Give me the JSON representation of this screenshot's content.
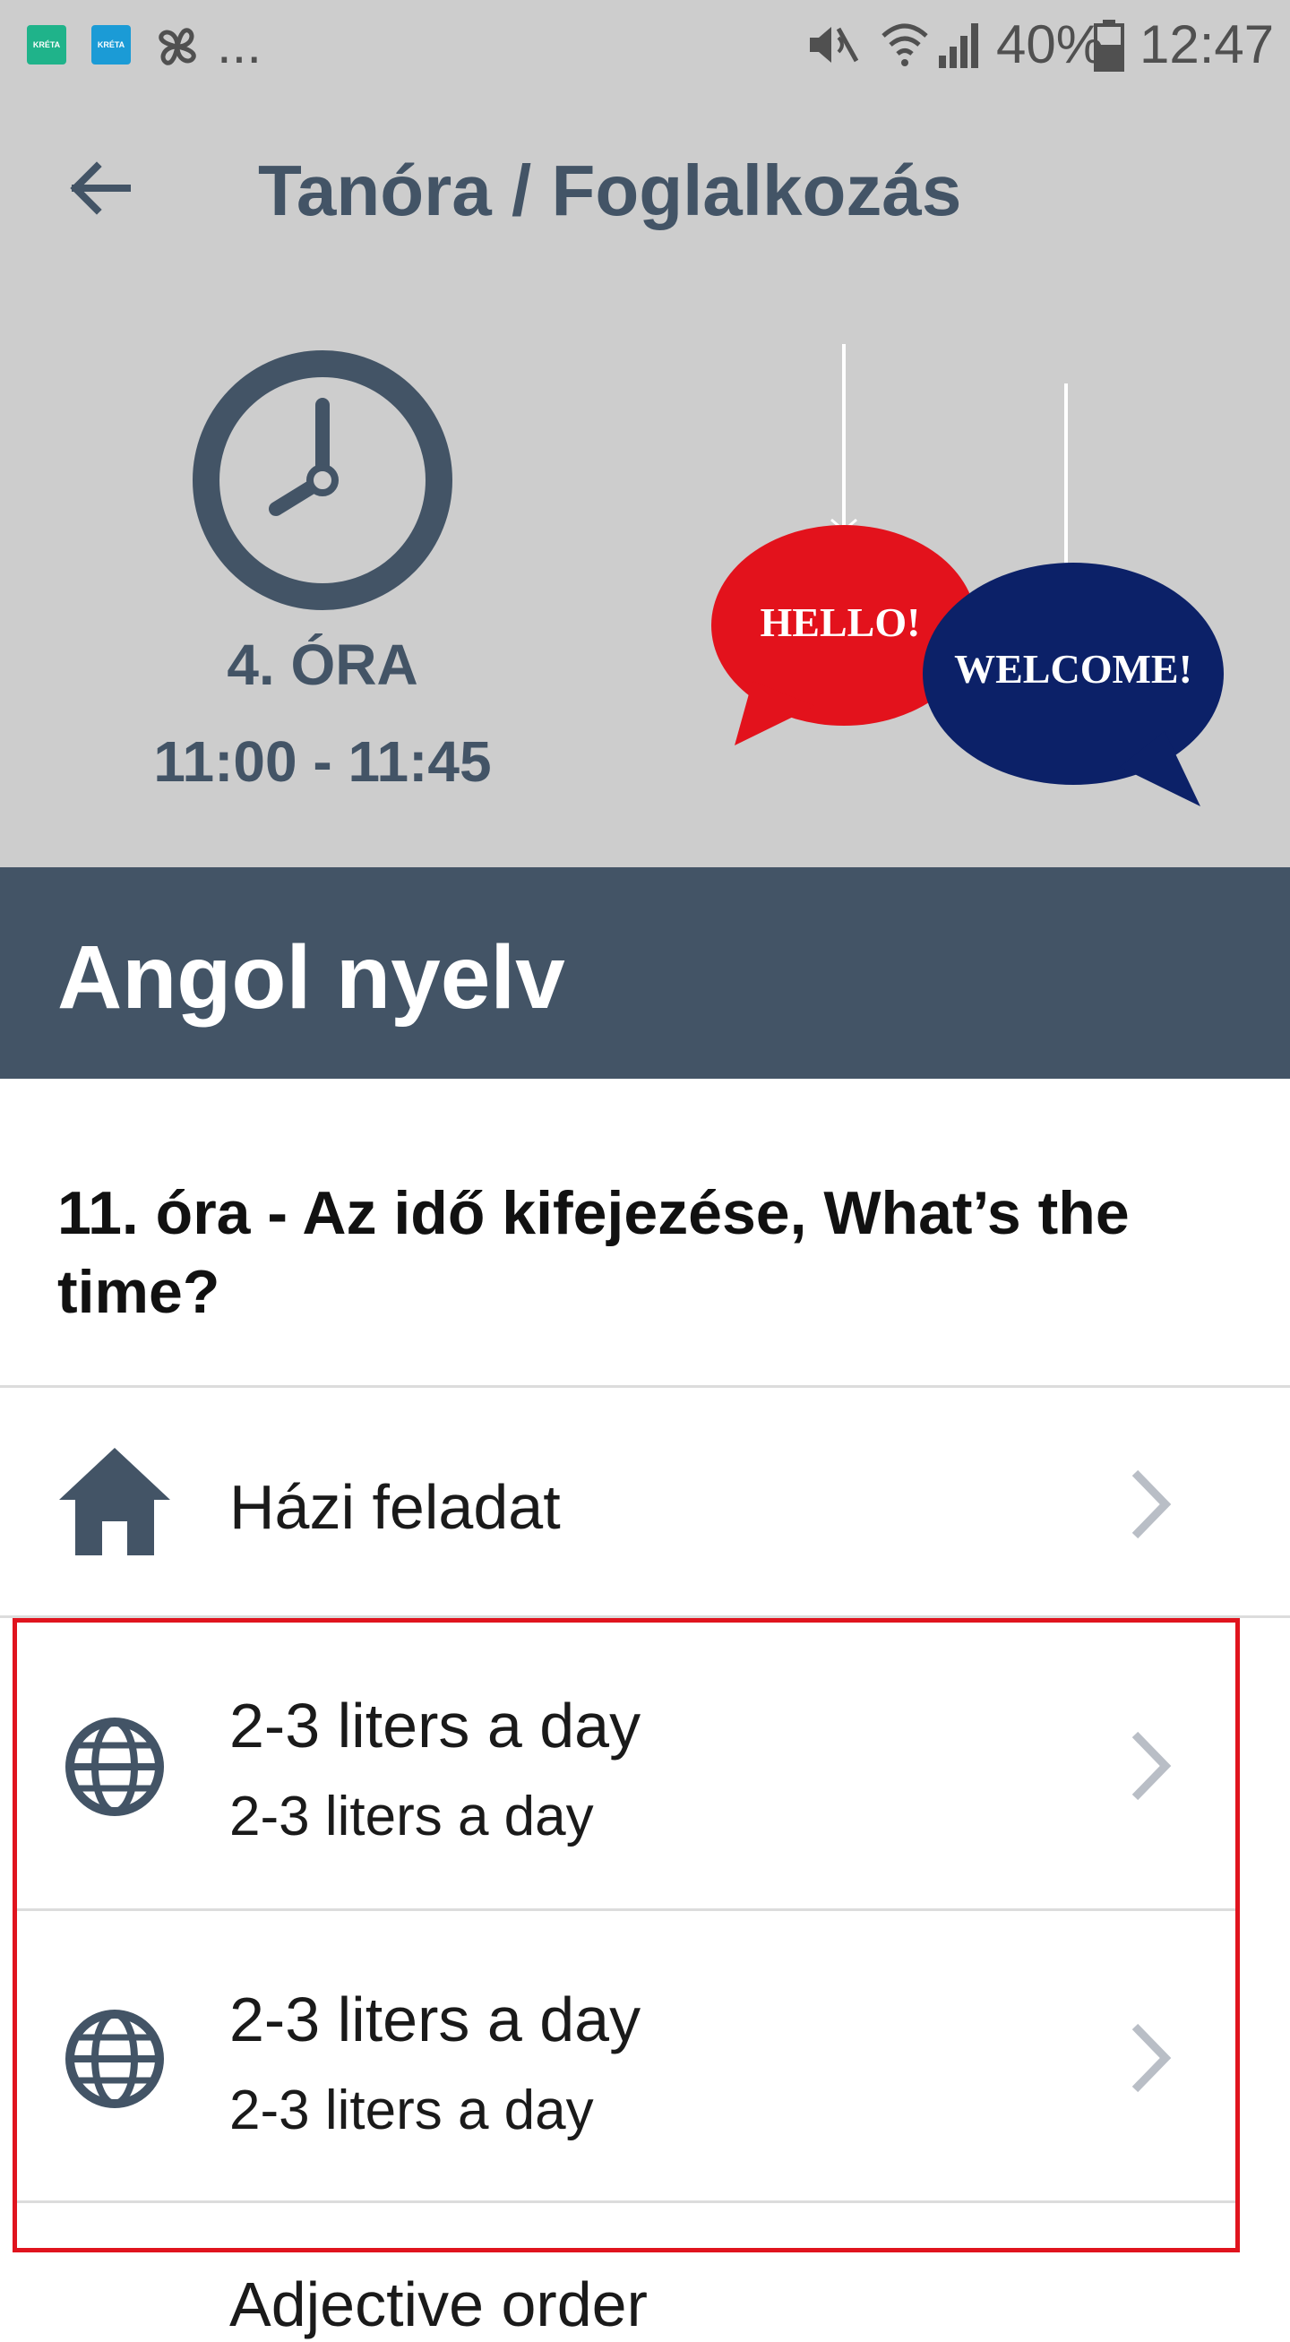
{
  "status_bar": {
    "notification_icons": [
      "kreta-app-icon",
      "kreta-app-icon",
      "pinwheel-icon"
    ],
    "more": "...",
    "icons": [
      "mute-icon",
      "wifi-icon",
      "signal-icon",
      "battery-icon"
    ],
    "battery": "40%",
    "clock": "12:47",
    "app_icon_label": "KRÉTA"
  },
  "header": {
    "title": "Tanóra / Foglalkozás",
    "back_icon": "arrow-left-icon"
  },
  "lesson": {
    "period": "4. ÓRA",
    "time_range": "11:00 - 11:45",
    "illustration": {
      "bubble_1": "HELLO!",
      "bubble_2": "WELCOME!",
      "colors": {
        "red": "#e3121c",
        "navy": "#0c2168"
      }
    },
    "subject": "Angol nyelv",
    "topic": "11. óra - Az idő kifejezése, What’s the time?"
  },
  "list": {
    "homework": {
      "label": "Házi feladat",
      "icon": "home-icon"
    },
    "links": [
      {
        "title": "2-3 liters a day",
        "subtitle": "2-3 liters a day",
        "icon": "globe-icon"
      },
      {
        "title": "2-3 liters a day",
        "subtitle": "2-3 liters a day",
        "icon": "globe-icon"
      }
    ],
    "partial_next": "Adjective order"
  },
  "colors": {
    "header_bg": "#cdcdcd",
    "primary": "#435466",
    "highlight": "#e0141e",
    "chevron": "#b9bec6"
  }
}
